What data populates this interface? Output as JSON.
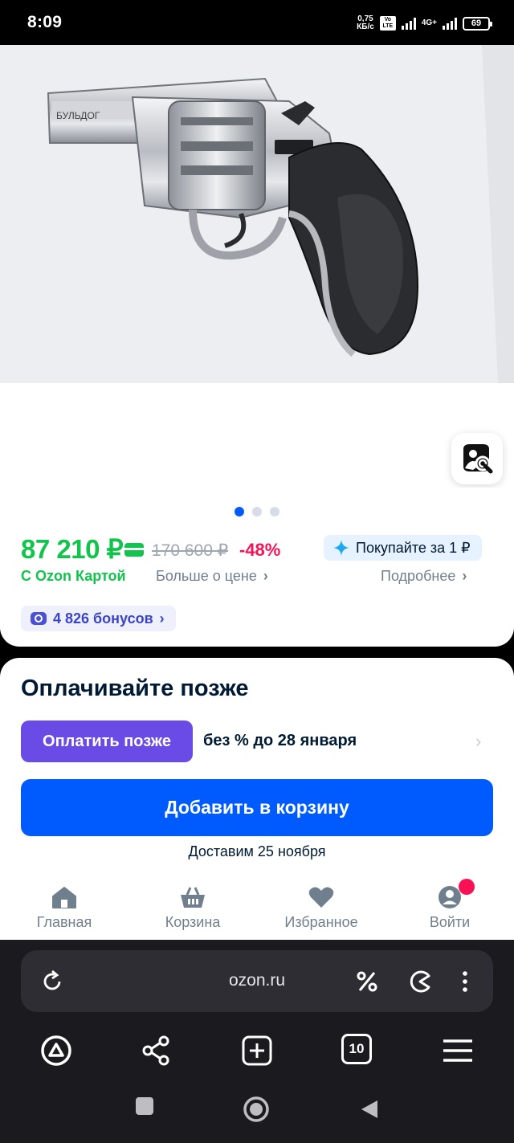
{
  "status_bar": {
    "time": "8:09",
    "speed_top": "0,75",
    "speed_bottom": "КБ/с",
    "volte_top": "Vo",
    "volte_bottom": "LTE",
    "network": "4G+",
    "battery": "69"
  },
  "product": {
    "image_alt": "Revolver photo",
    "engraving": "БУЛЬДОГ"
  },
  "gallery": {
    "total": 3,
    "active": 0
  },
  "price": {
    "current": "87 210 ₽",
    "old": "170 600 ₽",
    "discount": "-48%",
    "ozon_card_label": "С Ozon Картой",
    "more_price_label": "Больше о цене",
    "buy_for_label": "Покупайте за 1 ₽",
    "details_label": "Подробнее",
    "bonus_label": "4 826 бонусов",
    "accent_green": "#10c44c"
  },
  "pay_later": {
    "title": "Оплачивайте позже",
    "button": "Оплатить позже",
    "terms": "без % до 28 января"
  },
  "cart": {
    "button": "Добавить в корзину",
    "delivery": "Доставим 25 ноября",
    "accent_blue": "#005bff"
  },
  "nav": {
    "items": [
      {
        "label": "Главная",
        "icon": "home-icon"
      },
      {
        "label": "Корзина",
        "icon": "basket-icon"
      },
      {
        "label": "Избранное",
        "icon": "heart-icon"
      },
      {
        "label": "Войти",
        "icon": "profile-icon"
      }
    ]
  },
  "browser": {
    "url": "ozon.ru",
    "tabs_count": "10"
  }
}
